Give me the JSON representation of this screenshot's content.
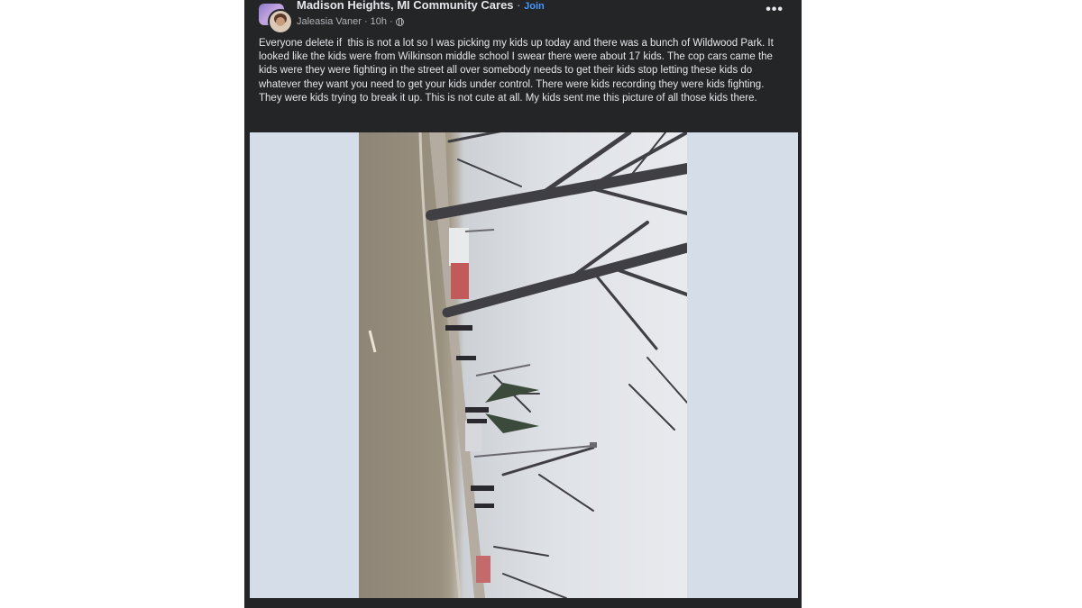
{
  "post": {
    "group_name": "Madison Heights, MI Community Cares",
    "separator": " · ",
    "join_label": "Join",
    "author": "Jaleasia Vaner",
    "time": "10h",
    "meta_separator": "·",
    "privacy_icon": "globe-icon",
    "more_icon": "more-options-icon",
    "more_label": "•••",
    "text": "Everyone delete if  this is not a lot so I was picking my kids up today and there was a bunch of Wildwood Park. It looked like the kids were from Wilkinson middle school I swear there were about 17 kids. The cop cars came the kids were they were fighting in the street all over somebody needs to get their kids stop letting these kids do whatever they want you need to get your kids under control. There were kids recording they were kids fighting. They were kids trying to break it up. This is not cute at all. My kids sent me this picture of all those kids there."
  },
  "colors": {
    "card_background": "#242526",
    "primary_text": "#e4e6eb",
    "secondary_text": "#b0b3b8",
    "join_link": "#4599ff",
    "media_background": "#d4dde8"
  }
}
